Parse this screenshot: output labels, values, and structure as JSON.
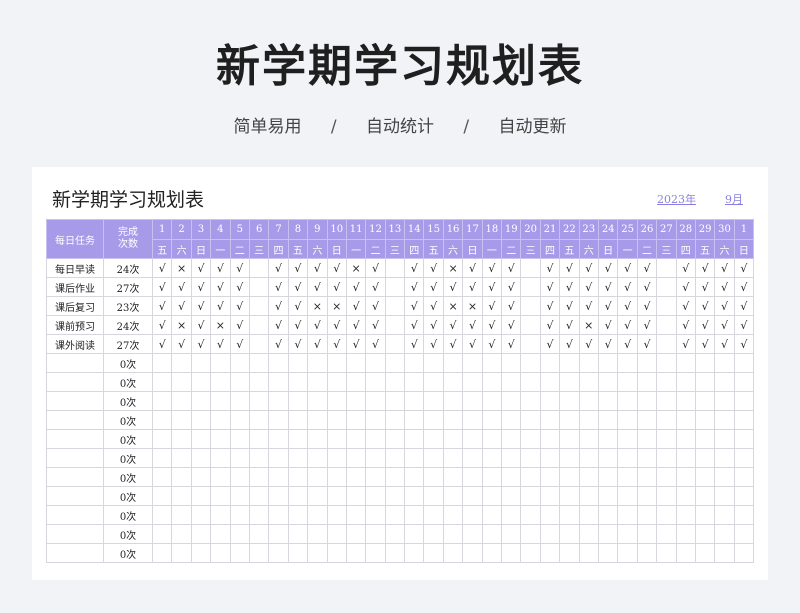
{
  "header": {
    "title": "新学期学习规划表",
    "features": [
      "简单易用",
      "自动统计",
      "自动更新"
    ],
    "separator": "/"
  },
  "sheet": {
    "title": "新学期学习规划表",
    "year": "2023年",
    "month": "9月",
    "col_task_header": "每日任务",
    "col_count_header": "完成次数",
    "days": [
      "1",
      "2",
      "3",
      "4",
      "5",
      "6",
      "7",
      "8",
      "9",
      "10",
      "11",
      "12",
      "13",
      "14",
      "15",
      "16",
      "17",
      "18",
      "19",
      "20",
      "21",
      "22",
      "23",
      "24",
      "25",
      "26",
      "27",
      "28",
      "29",
      "30",
      "1"
    ],
    "weekdays": [
      "五",
      "六",
      "日",
      "一",
      "二",
      "三",
      "四",
      "五",
      "六",
      "日",
      "一",
      "二",
      "三",
      "四",
      "五",
      "六",
      "日",
      "一",
      "二",
      "三",
      "四",
      "五",
      "六",
      "日",
      "一",
      "二",
      "三",
      "四",
      "五",
      "六",
      "日"
    ],
    "rows": [
      {
        "task": "每日早读",
        "count": "24次",
        "marks": [
          "√",
          "×",
          "√",
          "√",
          "√",
          "",
          "√",
          "√",
          "√",
          "√",
          "×",
          "√",
          "",
          "√",
          "√",
          "×",
          "√",
          "√",
          "√",
          "",
          "√",
          "√",
          "√",
          "√",
          "√",
          "√",
          "",
          "√",
          "√",
          "√",
          "√"
        ]
      },
      {
        "task": "课后作业",
        "count": "27次",
        "marks": [
          "√",
          "√",
          "√",
          "√",
          "√",
          "",
          "√",
          "√",
          "√",
          "√",
          "√",
          "√",
          "",
          "√",
          "√",
          "√",
          "√",
          "√",
          "√",
          "",
          "√",
          "√",
          "√",
          "√",
          "√",
          "√",
          "",
          "√",
          "√",
          "√",
          "√"
        ]
      },
      {
        "task": "课后复习",
        "count": "23次",
        "marks": [
          "√",
          "√",
          "√",
          "√",
          "√",
          "",
          "√",
          "√",
          "×",
          "×",
          "√",
          "√",
          "",
          "√",
          "√",
          "×",
          "×",
          "√",
          "√",
          "",
          "√",
          "√",
          "√",
          "√",
          "√",
          "√",
          "",
          "√",
          "√",
          "√",
          "√"
        ]
      },
      {
        "task": "课前预习",
        "count": "24次",
        "marks": [
          "√",
          "×",
          "√",
          "×",
          "√",
          "",
          "√",
          "√",
          "√",
          "√",
          "√",
          "√",
          "",
          "√",
          "√",
          "√",
          "√",
          "√",
          "√",
          "",
          "√",
          "√",
          "×",
          "√",
          "√",
          "√",
          "",
          "√",
          "√",
          "√",
          "√"
        ]
      },
      {
        "task": "课外阅读",
        "count": "27次",
        "marks": [
          "√",
          "√",
          "√",
          "√",
          "√",
          "",
          "√",
          "√",
          "√",
          "√",
          "√",
          "√",
          "",
          "√",
          "√",
          "√",
          "√",
          "√",
          "√",
          "",
          "√",
          "√",
          "√",
          "√",
          "√",
          "√",
          "",
          "√",
          "√",
          "√",
          "√"
        ]
      },
      {
        "task": "",
        "count": "0次",
        "marks": []
      },
      {
        "task": "",
        "count": "0次",
        "marks": []
      },
      {
        "task": "",
        "count": "0次",
        "marks": []
      },
      {
        "task": "",
        "count": "0次",
        "marks": []
      },
      {
        "task": "",
        "count": "0次",
        "marks": []
      },
      {
        "task": "",
        "count": "0次",
        "marks": []
      },
      {
        "task": "",
        "count": "0次",
        "marks": []
      },
      {
        "task": "",
        "count": "0次",
        "marks": []
      },
      {
        "task": "",
        "count": "0次",
        "marks": []
      },
      {
        "task": "",
        "count": "0次",
        "marks": []
      },
      {
        "task": "",
        "count": "0次",
        "marks": []
      }
    ]
  },
  "colors": {
    "header_bg": "#a79ae9",
    "page_bg": "#f2f3f7",
    "accent": "#8a7fe0"
  }
}
